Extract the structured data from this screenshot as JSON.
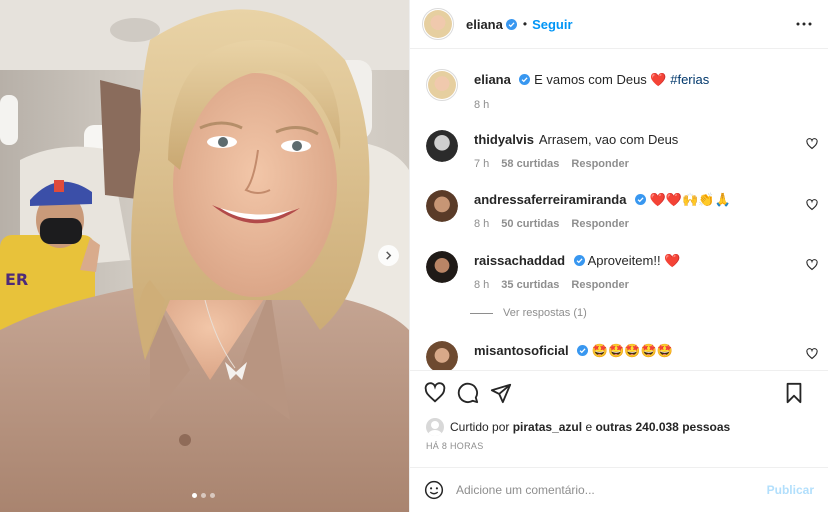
{
  "post": {
    "author": "eliana",
    "follow_label": "Seguir",
    "separator": "•",
    "caption": {
      "username": "eliana",
      "text": "E vamos com Deus ❤️ ",
      "hashtag": "#ferias",
      "time": "8 h"
    },
    "carousel": {
      "slide_count": 3,
      "active_index": 0
    }
  },
  "comments": [
    {
      "username": "thidyalvis",
      "verified": false,
      "text": "Arrasem, vao com Deus",
      "time": "7 h",
      "likes": "58 curtidas",
      "reply": "Responder"
    },
    {
      "username": "andressaferreiramiranda",
      "verified": true,
      "text": "❤️❤️🙌👏🙏",
      "time": "8 h",
      "likes": "50 curtidas",
      "reply": "Responder"
    },
    {
      "username": "raissachaddad",
      "verified": true,
      "text": "Aproveitem!! ❤️",
      "time": "8 h",
      "likes": "35 curtidas",
      "reply": "Responder"
    },
    {
      "username": "misantosoficial",
      "verified": true,
      "text": "🤩🤩🤩🤩🤩"
    }
  ],
  "view_replies": "Ver respostas (1)",
  "likes_line": {
    "prefix": "Curtido por",
    "liker": "piratas_azul",
    "middle": "e",
    "others": "outras 240.038 pessoas"
  },
  "time_ago": "HÁ 8 HORAS",
  "composer": {
    "placeholder": "Adicione um comentário...",
    "publish_label": "Publicar"
  },
  "colors": {
    "accent": "#0095f6",
    "verified": "#3897f0",
    "publish_disabled": "#b2dffc"
  }
}
